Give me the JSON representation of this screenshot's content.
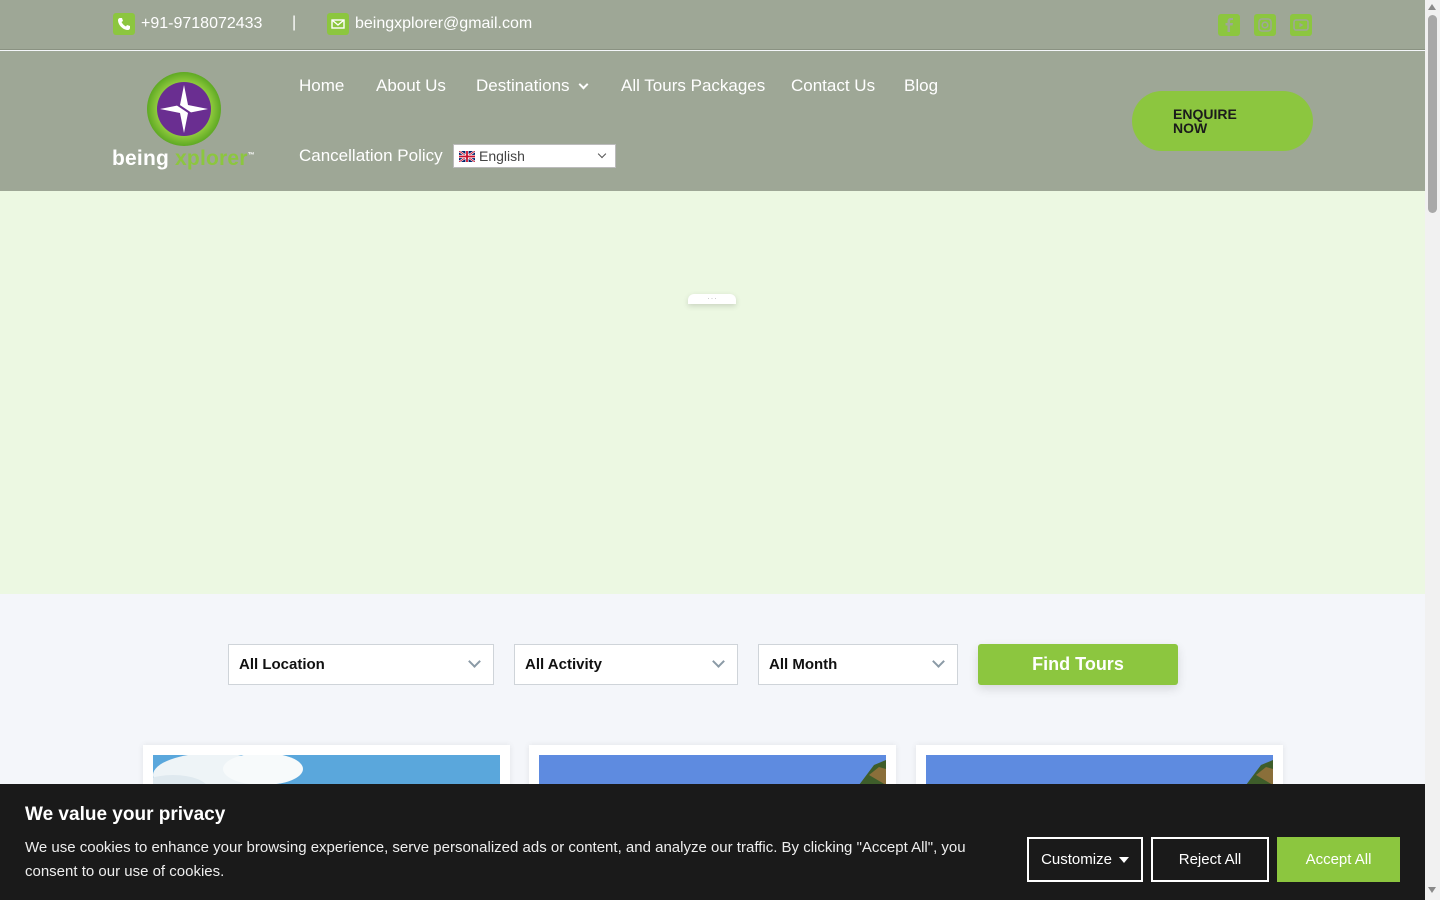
{
  "topbar": {
    "phone": "+91-9718072433",
    "separator": "|",
    "email": "beingxplorer@gmail.com",
    "social": [
      "facebook-icon",
      "instagram-icon",
      "youtube-icon"
    ]
  },
  "brand": {
    "word1": "being",
    "word2": "xplorer",
    "tm": "™"
  },
  "nav": {
    "home": "Home",
    "about": "About Us",
    "destinations": "Destinations",
    "packages": "All Tours Packages",
    "contact": "Contact Us",
    "blog": "Blog",
    "cancellation": "Cancellation Policy"
  },
  "language": {
    "selected": "English"
  },
  "enquire": {
    "line1": "ENQUIRE",
    "line2": "NOW"
  },
  "search": {
    "location": "All Location",
    "activity": "All Activity",
    "month": "All Month",
    "button": "Find Tours"
  },
  "cookie": {
    "title": "We value your privacy",
    "text": "We use cookies to enhance your browsing experience, serve personalized ads or content, and analyze our traffic. By clicking \"Accept All\", you consent to our use of cookies.",
    "customize": "Customize",
    "reject": "Reject All",
    "accept": "Accept All"
  },
  "colors": {
    "accent": "#8cc63f",
    "header_bg": "#9ea796",
    "hero_bg": "#ecf8e2",
    "cookie_bg": "#1a1a1a"
  }
}
